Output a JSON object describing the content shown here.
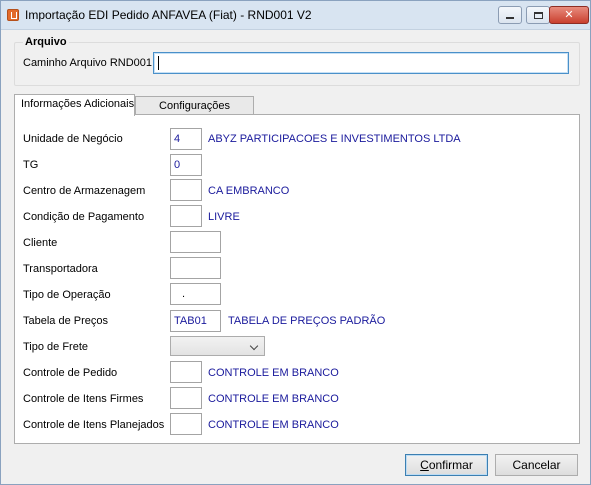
{
  "window": {
    "title": "Importação EDI Pedido ANFAVEA (Fiat) - RND001 V2",
    "min_glyph": "",
    "max_glyph": "",
    "close_glyph": "✕"
  },
  "arquivo": {
    "group_label": "Arquivo",
    "path_label": "Caminho Arquivo RND001",
    "path_value": ""
  },
  "tabs": [
    {
      "label": "Informações Adicionais",
      "active": true
    },
    {
      "label": "Configurações",
      "active": false
    }
  ],
  "fields": {
    "unidade": {
      "label": "Unidade de Negócio",
      "value": "4",
      "desc": "ABYZ PARTICIPACOES E INVESTIMENTOS LTDA"
    },
    "tg": {
      "label": "TG",
      "value": "0"
    },
    "centro": {
      "label": "Centro de Armazenagem",
      "value": "",
      "desc": "CA EMBRANCO"
    },
    "condicao": {
      "label": "Condição de Pagamento",
      "value": "",
      "desc": "LIVRE"
    },
    "cliente": {
      "label": "Cliente",
      "value": ""
    },
    "transportadora": {
      "label": "Transportadora",
      "value": ""
    },
    "tipo_operacao": {
      "label": "Tipo de Operação",
      "value": "."
    },
    "tabela_precos": {
      "label": "Tabela de Preços",
      "value": "TAB01",
      "desc": "TABELA DE PREÇOS PADRÃO"
    },
    "tipo_frete": {
      "label": "Tipo de Frete",
      "value": ""
    },
    "controle_pedido": {
      "label": "Controle de Pedido",
      "value": "",
      "desc": "CONTROLE EM BRANCO"
    },
    "controle_firmes": {
      "label": "Controle de Itens Firmes",
      "value": "",
      "desc": "CONTROLE EM BRANCO"
    },
    "controle_planejados": {
      "label": "Controle de Itens Planejados",
      "value": "",
      "desc": "CONTROLE EM BRANCO"
    }
  },
  "buttons": {
    "confirmar_first": "C",
    "confirmar_rest": "onfirmar",
    "cancelar": "Cancelar"
  },
  "colors": {
    "value_text": "#1a1a9c",
    "focus_border": "#4a90c9"
  }
}
